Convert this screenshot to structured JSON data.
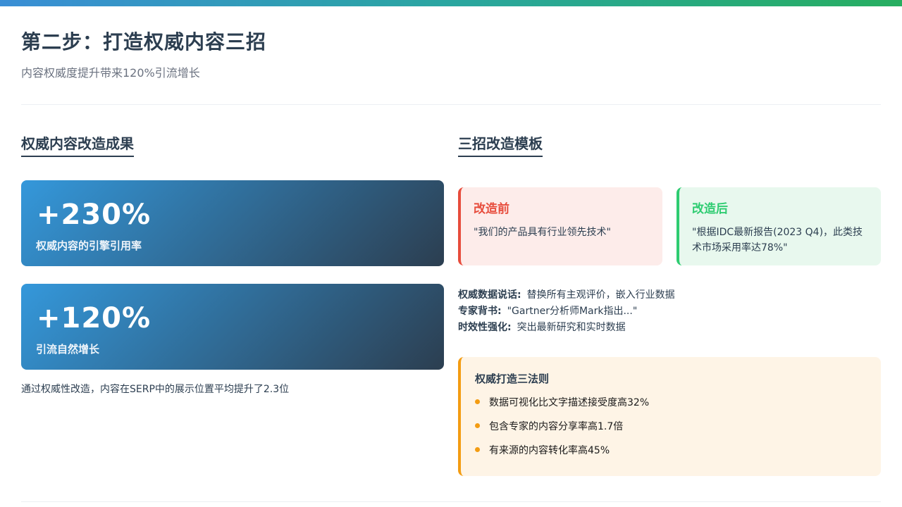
{
  "header": {
    "title": "第二步：打造权威内容三招",
    "subtitle": "内容权威度提升带来120%引流增长"
  },
  "left": {
    "heading": "权威内容改造成果",
    "stats": [
      {
        "value": "+230%",
        "label": "权威内容的引擎引用率"
      },
      {
        "value": "+120%",
        "label": "引流自然增长"
      }
    ],
    "note": "通过权威性改造，内容在SERP中的展示位置平均提升了2.3位"
  },
  "right": {
    "heading": "三招改造模板",
    "before": {
      "title": "改造前",
      "text": "\"我们的产品具有行业领先技术\""
    },
    "after": {
      "title": "改造后",
      "text": "\"根据IDC最新报告(2023 Q4)，此类技术市场采用率达78%\""
    },
    "tips": [
      {
        "label": "权威数据说话:",
        "text": "替换所有主观评价，嵌入行业数据"
      },
      {
        "label": "专家背书:",
        "text": "\"Gartner分析师Mark指出...\""
      },
      {
        "label": "时效性强化:",
        "text": "突出最新研究和实时数据"
      }
    ],
    "rules": {
      "title": "权威打造三法则",
      "items": [
        "数据可视化比文字描述接受度高32%",
        "包含专家的内容分享率高1.7倍",
        "有来源的内容转化率高45%"
      ]
    }
  },
  "colors": {
    "accent_blue": "#3498db",
    "dark": "#2c3e50",
    "before_red": "#e74c3c",
    "after_green": "#2ecc71",
    "rules_orange": "#f39c12"
  }
}
